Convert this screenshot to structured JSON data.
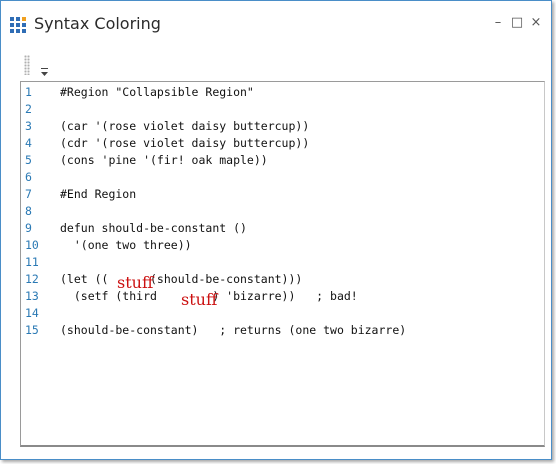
{
  "window": {
    "title": "Syntax Coloring",
    "controls": {
      "minimize": "–",
      "maximize": "□",
      "close": "×"
    },
    "icon": "app-grid-icon"
  },
  "toolbar": {
    "grip_icon": "grip-icon",
    "overflow_icon": "toolbar-overflow-icon"
  },
  "editor": {
    "lines": [
      {
        "num": "1",
        "text": "#Region \"Collapsible Region\""
      },
      {
        "num": "2",
        "text": ""
      },
      {
        "num": "3",
        "text": "(car '(rose violet daisy buttercup))"
      },
      {
        "num": "4",
        "text": "(cdr '(rose violet daisy buttercup))"
      },
      {
        "num": "5",
        "text": "(cons 'pine '(fir! oak maple))"
      },
      {
        "num": "6",
        "text": ""
      },
      {
        "num": "7",
        "text": "#End Region"
      },
      {
        "num": "8",
        "text": ""
      },
      {
        "num": "9",
        "text": "defun should-be-constant ()"
      },
      {
        "num": "10",
        "text": "  '(one two three))"
      },
      {
        "num": "11",
        "text": ""
      },
      {
        "num": "12",
        "text": "(let ((      (should-be-constant)))"
      },
      {
        "num": "13",
        "text": "  (setf (third        ) 'bizarre))   ; bad!"
      },
      {
        "num": "14",
        "text": ""
      },
      {
        "num": "15",
        "text": "(should-be-constant)   ; returns (one two bizarre)"
      }
    ],
    "overlays": [
      "stuff",
      "stuff"
    ]
  },
  "colors": {
    "line_number": "#2a79b4",
    "overlay_text": "#cc1111",
    "window_border": "#4a8ec8"
  }
}
